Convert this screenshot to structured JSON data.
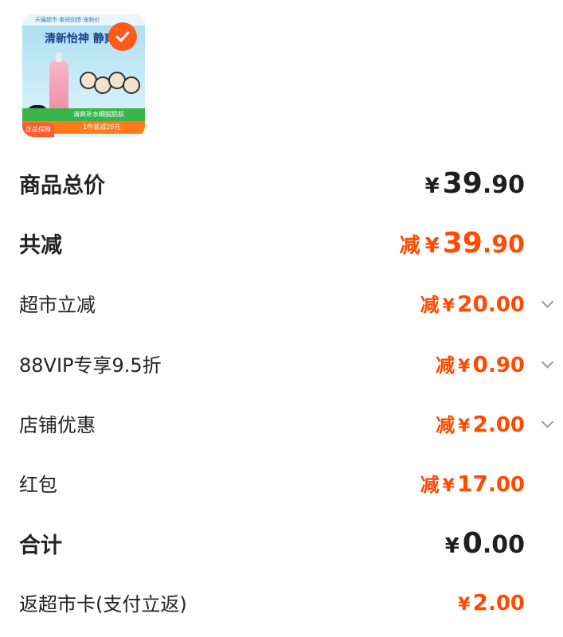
{
  "product": {
    "banner_top": "天猫超市·重磅回馈·宠粉价",
    "headline": "清新怡神 静爽",
    "badge_green": "清爽补水细腻肌肤",
    "badge_orange": "1件装减20元",
    "guarantee": "正品保障"
  },
  "rows": [
    {
      "label": "商品总价",
      "prefix": "",
      "yen": "¥",
      "int": "39",
      "dec": ".90"
    },
    {
      "label": "共减",
      "prefix": "减",
      "yen": "¥",
      "int": "39",
      "dec": ".90"
    },
    {
      "label": "超市立减",
      "prefix": "减",
      "yen": "¥",
      "int": "20",
      "dec": ".00"
    },
    {
      "label": "88VIP专享9.5折",
      "prefix": "减",
      "yen": "¥",
      "int": "0",
      "dec": ".90"
    },
    {
      "label": "店铺优惠",
      "prefix": "减",
      "yen": "¥",
      "int": "2",
      "dec": ".00"
    },
    {
      "label": "红包",
      "prefix": "减",
      "yen": "¥",
      "int": "17",
      "dec": ".00"
    },
    {
      "label": "合计",
      "prefix": "",
      "yen": "¥",
      "int": "0",
      "dec": ".00"
    },
    {
      "label": "返超市卡(支付立返)",
      "prefix": "",
      "yen": "¥",
      "int": "2",
      "dec": ".00"
    }
  ],
  "icons": {
    "selected": "check-icon",
    "expand": "chevron-down-icon"
  },
  "colors": {
    "accent": "#ff4a00",
    "text": "#1f1f1f",
    "chevron": "#9a9a9a"
  }
}
